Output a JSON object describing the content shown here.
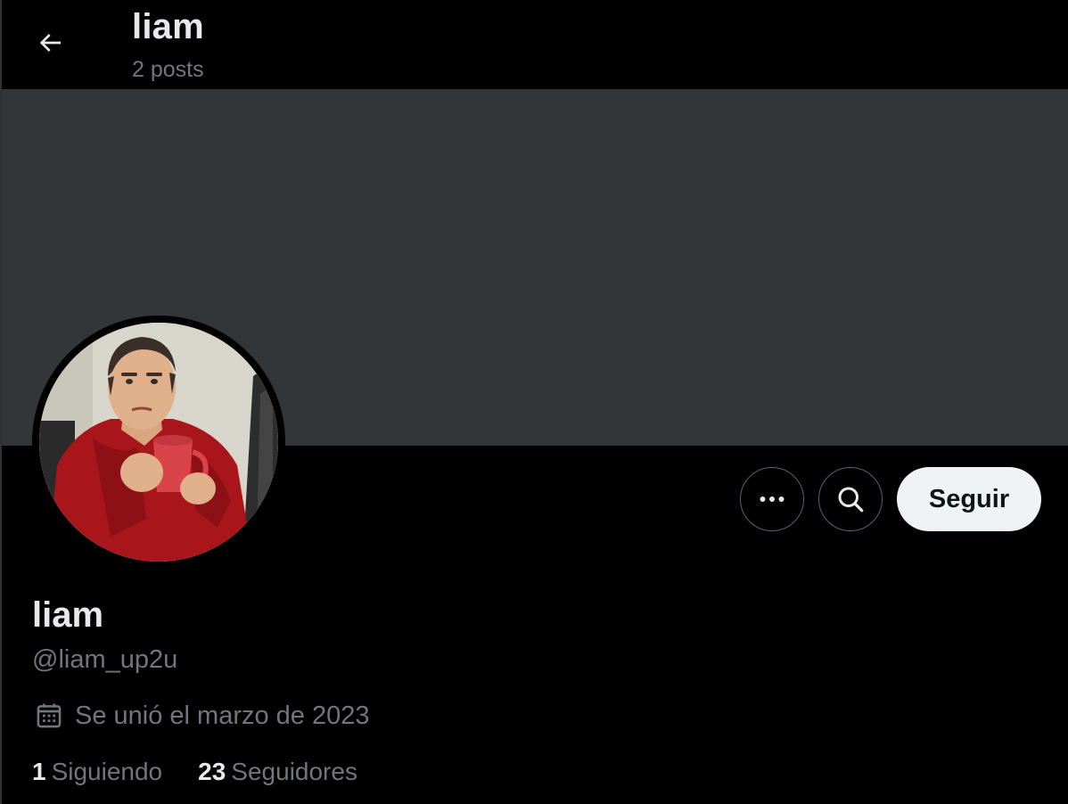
{
  "header": {
    "title": "liam",
    "subtitle": "2 posts"
  },
  "profile": {
    "display_name": "liam",
    "handle": "@liam_up2u",
    "joined": "Se unió el marzo de 2023",
    "following_count": "1",
    "following_label": "Siguiendo",
    "followers_count": "23",
    "followers_label": "Seguidores"
  },
  "actions": {
    "follow_label": "Seguir",
    "more_icon": "more-horizontal-icon",
    "search_icon": "search-icon"
  },
  "icons": {
    "back": "arrow-left-icon",
    "calendar": "calendar-icon"
  },
  "colors": {
    "background": "#000000",
    "banner": "#333639",
    "text_primary": "#e7e9ea",
    "text_secondary": "#71767b",
    "follow_button_bg": "#eff3f4",
    "follow_button_text": "#0f1419",
    "outline": "#536471"
  }
}
